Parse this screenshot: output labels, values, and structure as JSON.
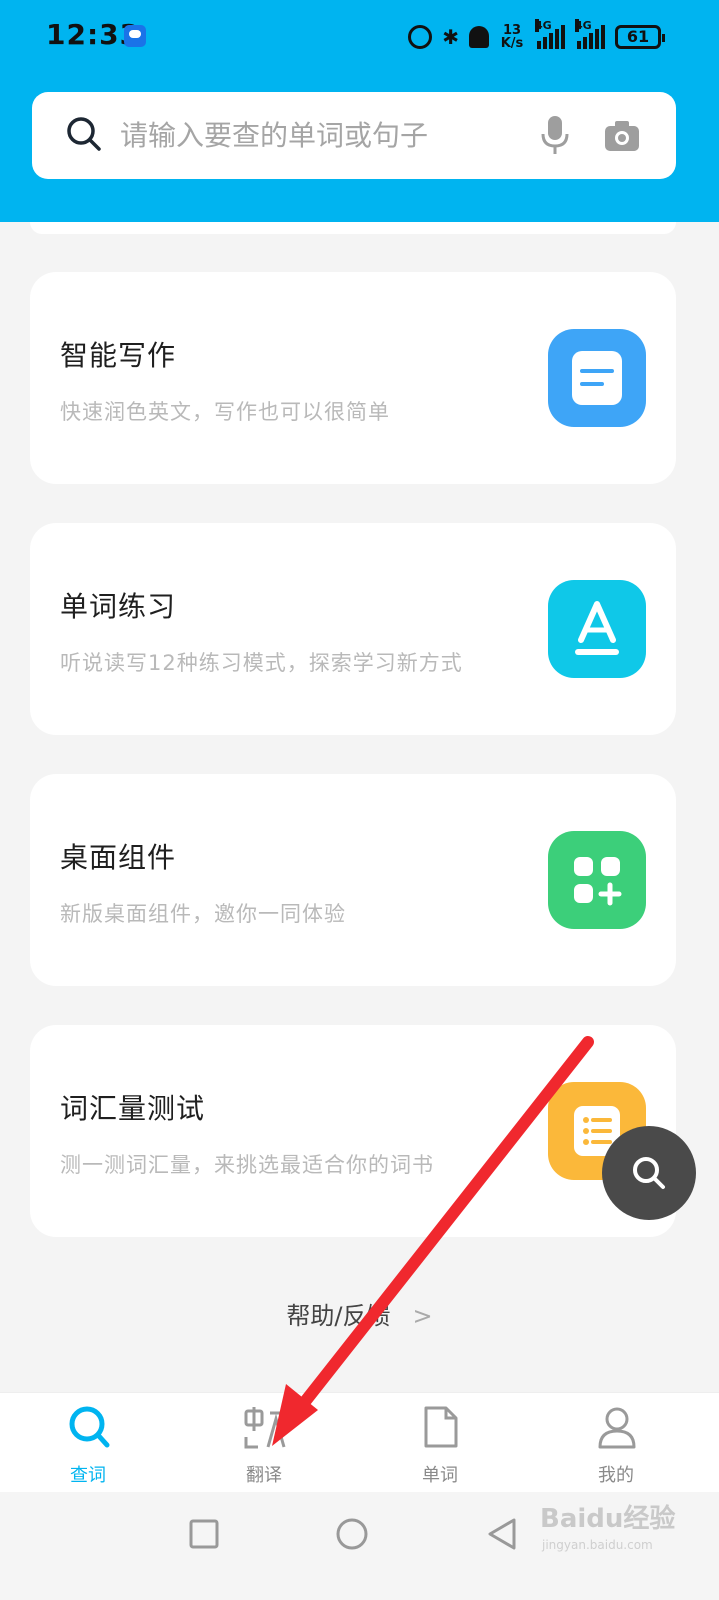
{
  "status_bar": {
    "time": "12:33",
    "net_speed_value": "13",
    "net_speed_unit": "K/s",
    "network_1": "4G",
    "network_2": "4G",
    "battery": "61"
  },
  "search": {
    "placeholder": "请输入要查的单词或句子"
  },
  "cards": [
    {
      "title": "智能写作",
      "subtitle": "快速润色英文，写作也可以很简单",
      "icon": "document-lines-icon",
      "color": "#3ea5f7"
    },
    {
      "title": "单词练习",
      "subtitle": "听说读写12种练习模式，探索学习新方式",
      "icon": "letter-a-icon",
      "color": "#0fc8e8"
    },
    {
      "title": "桌面组件",
      "subtitle": "新版桌面组件，邀你一同体验",
      "icon": "widgets-grid-icon",
      "color": "#3ccf7a"
    },
    {
      "title": "词汇量测试",
      "subtitle": "测一测词汇量，来挑选最适合你的词书",
      "icon": "list-checklist-icon",
      "color": "#fbb83a"
    }
  ],
  "help": {
    "label": "帮助/反馈",
    "chevron": ">"
  },
  "bottom_nav": [
    {
      "label": "查词",
      "icon": "search-icon",
      "active": true
    },
    {
      "label": "翻译",
      "icon": "translate-icon",
      "active": false
    },
    {
      "label": "单词",
      "icon": "wordbook-icon",
      "active": false
    },
    {
      "label": "我的",
      "icon": "profile-icon",
      "active": false
    }
  ],
  "watermark": {
    "text": "Baidu经验",
    "sub": "jingyan.baidu.com"
  },
  "colors": {
    "brand_blue": "#00b4f0",
    "annotation_arrow": "#f0282e"
  }
}
